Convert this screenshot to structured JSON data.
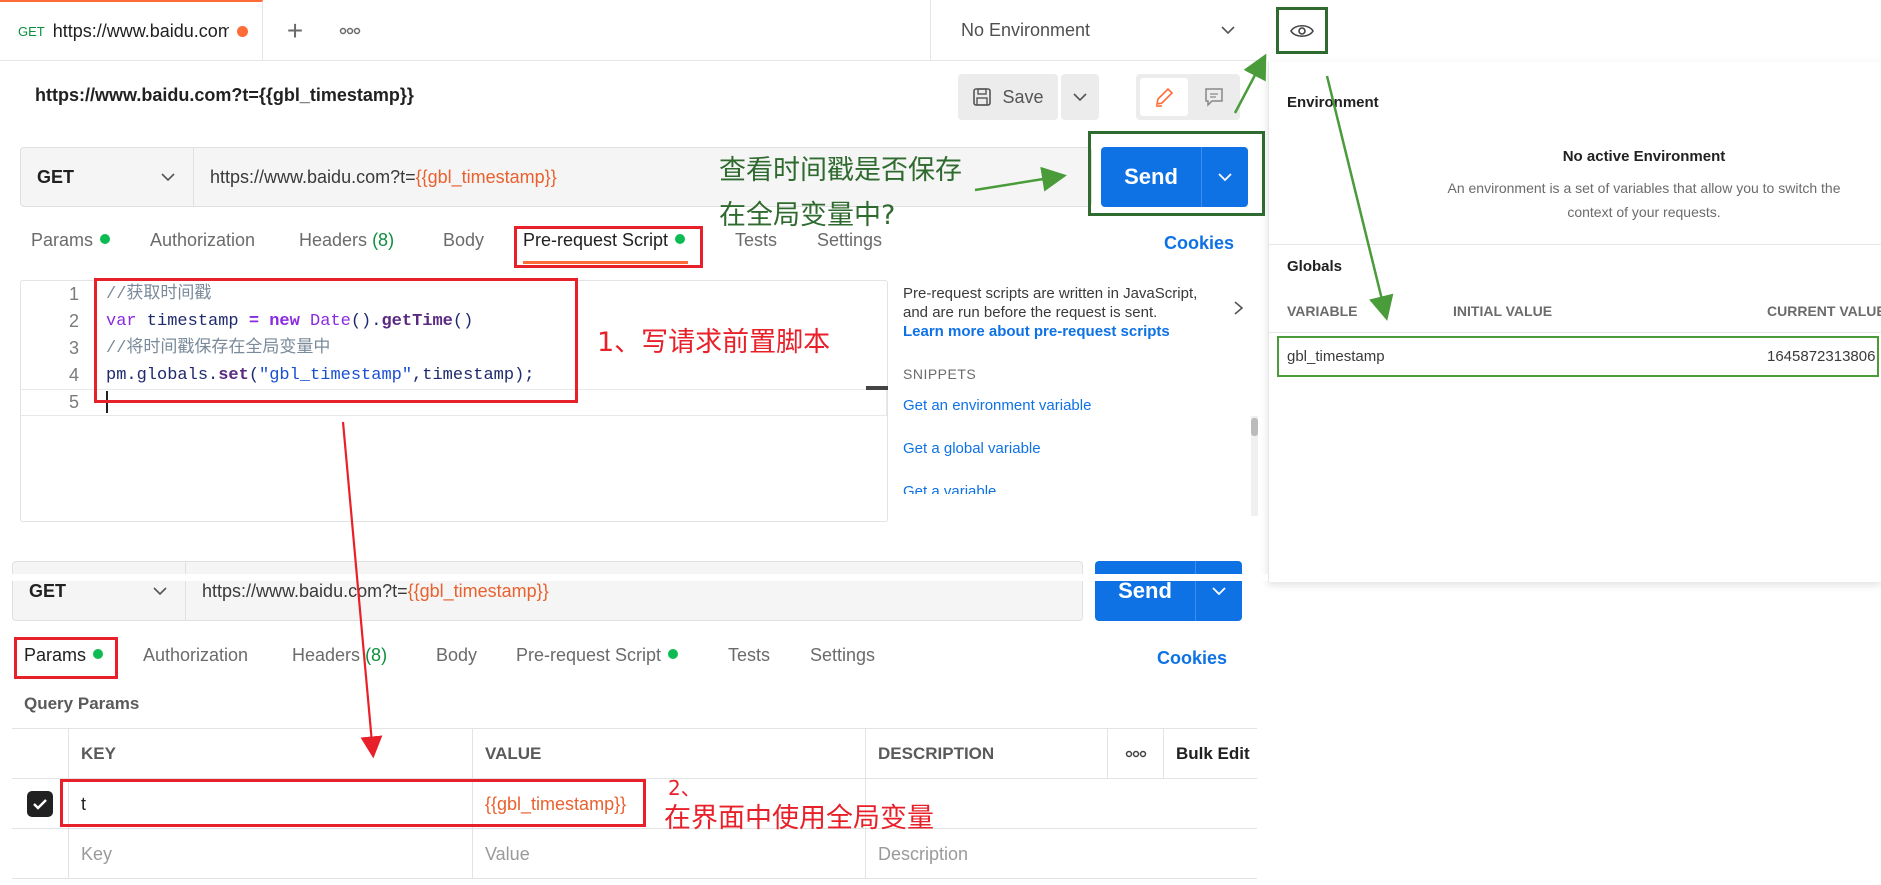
{
  "tabbar": {
    "active_tab": {
      "method": "GET",
      "title": "https://www.baidu.com"
    },
    "new_tab_label": "+",
    "more_label": "ooo",
    "environment": "No Environment"
  },
  "request": {
    "name": "https://www.baidu.com?t={{gbl_timestamp}}",
    "save_label": "Save",
    "method": "GET",
    "url_base": "https://www.baidu.com?t=",
    "url_var": "{{gbl_timestamp}}",
    "send_label": "Send"
  },
  "tabs": {
    "params": "Params",
    "authorization": "Authorization",
    "headers": "Headers",
    "headers_count": "(8)",
    "body": "Body",
    "pre_request": "Pre-request Script",
    "tests": "Tests",
    "settings": "Settings",
    "cookies": "Cookies"
  },
  "editor": {
    "line_numbers": [
      "1",
      "2",
      "3",
      "4",
      "5"
    ],
    "line1_comment": "//获取时间戳",
    "line2": {
      "kw_var": "var",
      "name": " timestamp ",
      "eq": "=",
      "kw_new": " new ",
      "cls": "Date",
      "p1": "().",
      "method": "getTime",
      "p2": "()"
    },
    "line3_comment": "//将时间戳保存在全局变量中",
    "line4": {
      "obj": "pm.globals.",
      "method": "set",
      "p1": "(",
      "str": "\"gbl_timestamp\"",
      "rest": ",timestamp);"
    }
  },
  "help": {
    "description": "Pre-request scripts are written in JavaScript, and are run before the request is sent.",
    "learn_more": "Learn more about pre-request scripts",
    "snippets_heading": "SNIPPETS",
    "snippets": [
      "Get an environment variable",
      "Get a global variable",
      "Get a variable"
    ]
  },
  "env_panel": {
    "environment_heading": "Environment",
    "no_env_title": "No active Environment",
    "no_env_desc_1": "An environment is a set of variables that allow you to switch the",
    "no_env_desc_2": "context of your requests.",
    "globals_heading": "Globals",
    "columns": [
      "VARIABLE",
      "INITIAL VALUE",
      "CURRENT VALUE"
    ],
    "row": {
      "variable": "gbl_timestamp",
      "initial": "",
      "current": "1645872313806"
    }
  },
  "lower": {
    "method": "GET",
    "url_base": "https://www.baidu.com?t=",
    "url_var": "{{gbl_timestamp}}",
    "send_label": "Send",
    "query_params_title": "Query Params",
    "columns": {
      "key": "KEY",
      "value": "VALUE",
      "description": "DESCRIPTION",
      "more": "ooo",
      "bulk_edit": "Bulk Edit"
    },
    "row": {
      "checked": true,
      "key": "t",
      "value": "{{gbl_timestamp}}"
    },
    "placeholder_row": {
      "key": "Key",
      "value": "Value",
      "description": "Description"
    }
  },
  "annotations": {
    "step1": "1、写请求前置脚本",
    "step2_num": "2、",
    "step2_text": "在界面中使用全局变量",
    "question_line1": "查看时间戳是否保存",
    "question_line2": "在全局变量中?"
  },
  "colors": {
    "accent": "#0e72e5",
    "orange": "#ff6c37",
    "green_dot": "#0cbb52",
    "annotation_red": "#e8202a",
    "annotation_green": "#2f6a2f"
  }
}
